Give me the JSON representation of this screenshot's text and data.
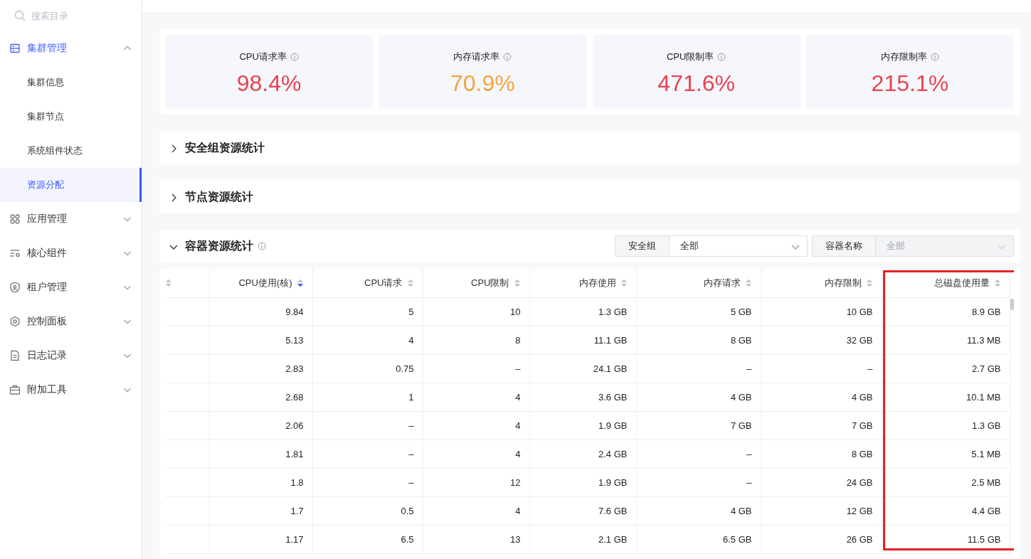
{
  "sidebar": {
    "search": {
      "placeholder": "搜索目录"
    },
    "groups": [
      {
        "label": "集群管理",
        "kind": "server",
        "expanded": true,
        "selected": true,
        "children": [
          {
            "label": "集群信息",
            "selected": false
          },
          {
            "label": "集群节点",
            "selected": false
          },
          {
            "label": "系统组件状态",
            "selected": false
          },
          {
            "label": "资源分配",
            "selected": true
          }
        ]
      },
      {
        "label": "应用管理",
        "kind": "apps",
        "expanded": false,
        "selected": false
      },
      {
        "label": "核心组件",
        "kind": "components",
        "expanded": false,
        "selected": false
      },
      {
        "label": "租户管理",
        "kind": "tenant",
        "expanded": false,
        "selected": false
      },
      {
        "label": "控制面板",
        "kind": "settings",
        "expanded": false,
        "selected": false
      },
      {
        "label": "日志记录",
        "kind": "log",
        "expanded": false,
        "selected": false
      },
      {
        "label": "附加工具",
        "kind": "tools",
        "expanded": false,
        "selected": false
      }
    ]
  },
  "stats": [
    {
      "label": "CPU请求率",
      "value": "98.4%",
      "color": "#e8434f"
    },
    {
      "label": "内存请求率",
      "value": "70.9%",
      "color": "#f5a23a"
    },
    {
      "label": "CPU限制率",
      "value": "471.6%",
      "color": "#e8434f"
    },
    {
      "label": "内存限制率",
      "value": "215.1%",
      "color": "#e8434f"
    }
  ],
  "sections": [
    {
      "title": "安全组资源统计",
      "expanded": false
    },
    {
      "title": "节点资源统计",
      "expanded": false
    },
    {
      "title": "容器资源统计",
      "expanded": true
    }
  ],
  "filters": [
    {
      "label": "安全组",
      "value": "全部",
      "disabled": false
    },
    {
      "label": "容器名称",
      "placeholder": "全部",
      "disabled": true
    }
  ],
  "table": {
    "columns": [
      {
        "sorted": false,
        "highlighted": false
      },
      {
        "label": "CPU使用(核)",
        "sorted": true,
        "highlighted": false
      },
      {
        "label": "CPU请求",
        "sorted": false,
        "highlighted": false
      },
      {
        "label": "CPU限制",
        "sorted": false,
        "highlighted": false
      },
      {
        "label": "内存使用",
        "sorted": false,
        "highlighted": false
      },
      {
        "label": "内存请求",
        "sorted": false,
        "highlighted": false
      },
      {
        "label": "内存限制",
        "sorted": false,
        "highlighted": false
      },
      {
        "label": "总磁盘使用量",
        "sorted": false,
        "highlighted": true
      }
    ],
    "rows": [
      [
        "",
        "9.84",
        "5",
        "10",
        "1.3 GB",
        "5 GB",
        "10 GB",
        "8.9 GB"
      ],
      [
        "",
        "5.13",
        "4",
        "8",
        "11.1 GB",
        "8 GB",
        "32 GB",
        "11.3 MB"
      ],
      [
        "",
        "2.83",
        "0.75",
        "–",
        "24.1 GB",
        "–",
        "–",
        "2.7 GB"
      ],
      [
        "",
        "2.68",
        "1",
        "4",
        "3.6 GB",
        "4 GB",
        "4 GB",
        "10.1 MB"
      ],
      [
        "",
        "2.06",
        "–",
        "4",
        "1.9 GB",
        "7 GB",
        "7 GB",
        "1.3 GB"
      ],
      [
        "",
        "1.81",
        "–",
        "4",
        "2.4 GB",
        "–",
        "8 GB",
        "5.1 MB"
      ],
      [
        "",
        "1.8",
        "–",
        "12",
        "1.9 GB",
        "–",
        "24 GB",
        "2.5 MB"
      ],
      [
        "",
        "1.7",
        "0.5",
        "4",
        "7.6 GB",
        "4 GB",
        "12 GB",
        "4.4 GB"
      ],
      [
        "",
        "1.17",
        "6.5",
        "13",
        "2.1 GB",
        "6.5 GB",
        "26 GB",
        "11.5 GB"
      ]
    ]
  }
}
